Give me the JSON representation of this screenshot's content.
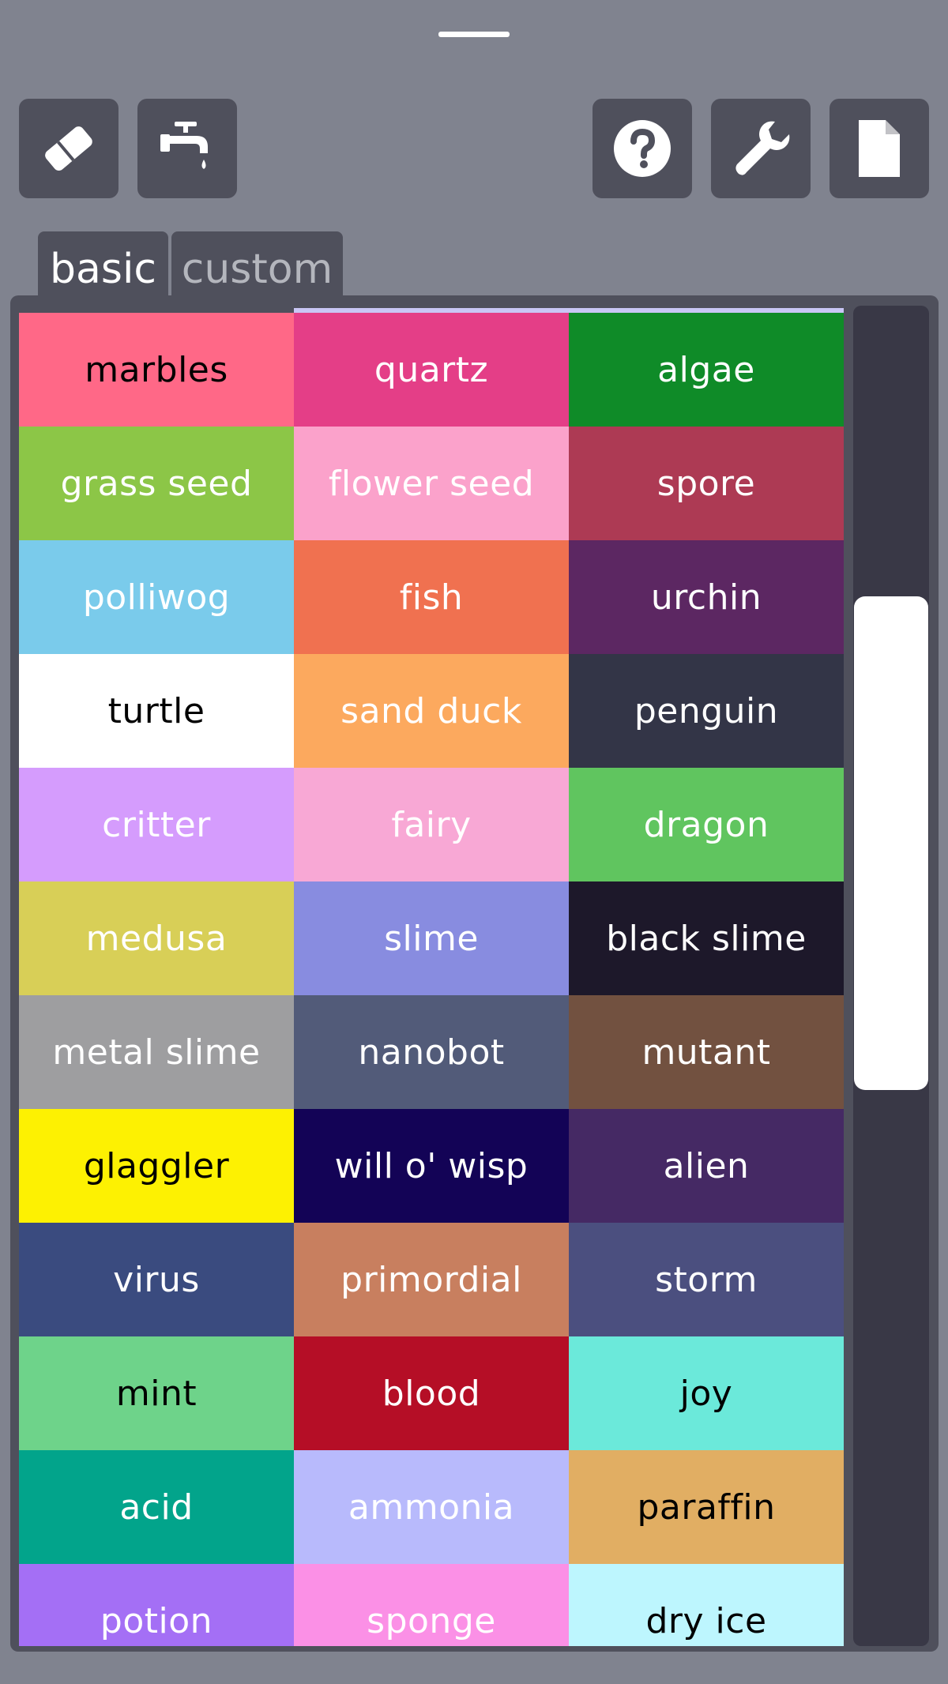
{
  "toolbar": {
    "left": [
      {
        "icon": "eraser-icon",
        "name": "eraser-button"
      },
      {
        "icon": "faucet-icon",
        "name": "faucet-button"
      }
    ],
    "right": [
      {
        "icon": "help-icon",
        "name": "help-button"
      },
      {
        "icon": "wrench-icon",
        "name": "settings-button"
      },
      {
        "icon": "file-icon",
        "name": "file-button"
      }
    ]
  },
  "tabs": {
    "basic": "basic",
    "custom": "custom",
    "active": "basic"
  },
  "elements": [
    {
      "label": "marbles",
      "bg": "#ff6887",
      "fg": "#000000"
    },
    {
      "label": "quartz",
      "bg": "#e43e87",
      "fg": "#ffffff"
    },
    {
      "label": "algae",
      "bg": "#0f8b28",
      "fg": "#ffffff"
    },
    {
      "label": "grass seed",
      "bg": "#8cc647",
      "fg": "#ffffff"
    },
    {
      "label": "flower seed",
      "bg": "#fba2cb",
      "fg": "#ffffff"
    },
    {
      "label": "spore",
      "bg": "#ad3a54",
      "fg": "#ffffff"
    },
    {
      "label": "polliwog",
      "bg": "#7acbeb",
      "fg": "#ffffff"
    },
    {
      "label": "fish",
      "bg": "#f07150",
      "fg": "#ffffff"
    },
    {
      "label": "urchin",
      "bg": "#5c2762",
      "fg": "#ffffff"
    },
    {
      "label": "turtle",
      "bg": "#ffffff",
      "fg": "#000000"
    },
    {
      "label": "sand duck",
      "bg": "#fca95e",
      "fg": "#ffffff"
    },
    {
      "label": "penguin",
      "bg": "#333547",
      "fg": "#ffffff"
    },
    {
      "label": "critter",
      "bg": "#d59cfd",
      "fg": "#ffffff"
    },
    {
      "label": "fairy",
      "bg": "#f8a8d5",
      "fg": "#ffffff"
    },
    {
      "label": "dragon",
      "bg": "#60c55f",
      "fg": "#ffffff"
    },
    {
      "label": "medusa",
      "bg": "#d8cf57",
      "fg": "#ffffff"
    },
    {
      "label": "slime",
      "bg": "#888ce0",
      "fg": "#ffffff"
    },
    {
      "label": "black slime",
      "bg": "#1d182a",
      "fg": "#ffffff"
    },
    {
      "label": "metal slime",
      "bg": "#9e9ea0",
      "fg": "#ffffff"
    },
    {
      "label": "nanobot",
      "bg": "#525b79",
      "fg": "#ffffff"
    },
    {
      "label": "mutant",
      "bg": "#725140",
      "fg": "#ffffff"
    },
    {
      "label": "glaggler",
      "bg": "#fdf102",
      "fg": "#000000"
    },
    {
      "label": "will o' wisp",
      "bg": "#130356",
      "fg": "#ffffff"
    },
    {
      "label": "alien",
      "bg": "#452964",
      "fg": "#ffffff"
    },
    {
      "label": "virus",
      "bg": "#3a4b7f",
      "fg": "#ffffff"
    },
    {
      "label": "primordial",
      "bg": "#c87f5f",
      "fg": "#ffffff"
    },
    {
      "label": "storm",
      "bg": "#4b4f7f",
      "fg": "#ffffff"
    },
    {
      "label": "mint",
      "bg": "#6ed38a",
      "fg": "#000000"
    },
    {
      "label": "blood",
      "bg": "#b50e26",
      "fg": "#ffffff"
    },
    {
      "label": "joy",
      "bg": "#6be9da",
      "fg": "#000000"
    },
    {
      "label": "acid",
      "bg": "#02a48b",
      "fg": "#ffffff"
    },
    {
      "label": "ammonia",
      "bg": "#b8bafc",
      "fg": "#ffffff"
    },
    {
      "label": "paraffin",
      "bg": "#e1ae63",
      "fg": "#000000"
    },
    {
      "label": "potion",
      "bg": "#a46ff5",
      "fg": "#ffffff"
    },
    {
      "label": "sponge",
      "bg": "#fb90e6",
      "fg": "#ffffff"
    },
    {
      "label": "dry ice",
      "bg": "#bdf6fe",
      "fg": "#000000"
    }
  ]
}
